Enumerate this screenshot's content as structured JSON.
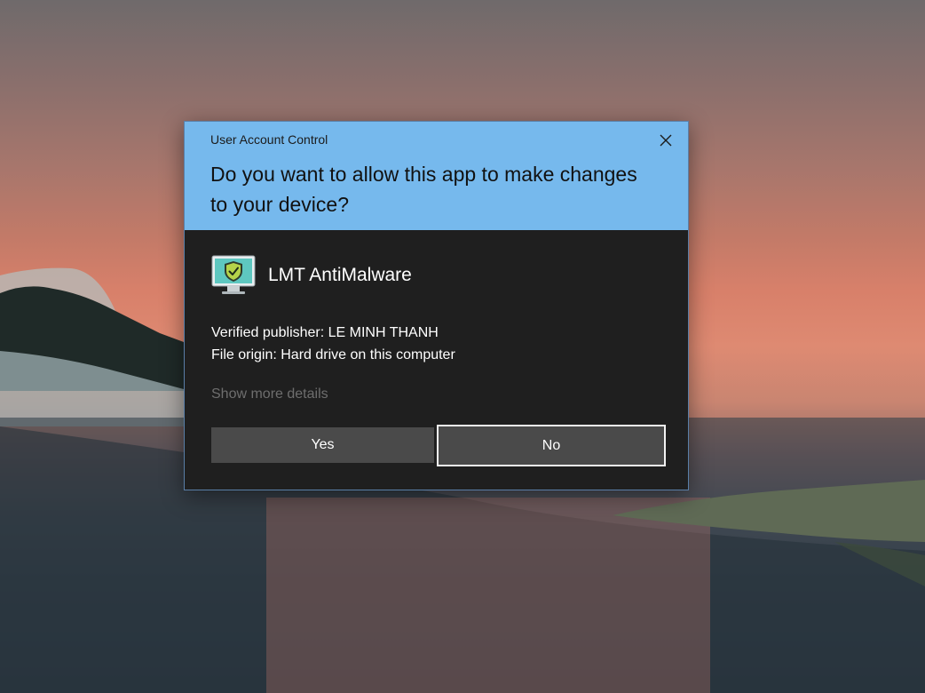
{
  "dialog": {
    "caption": "User Account Control",
    "question": "Do you want to allow this app to make changes to your device?",
    "app_name": "LMT AntiMalware",
    "app_icon": "monitor-shield-check-icon",
    "publisher_line": "Verified publisher: LE MINH THANH",
    "origin_line": "File origin: Hard drive on this computer",
    "more_details": "Show more details",
    "yes_label": "Yes",
    "no_label": "No",
    "close_icon": "close-icon"
  },
  "colors": {
    "header_bg": "#76b9ed",
    "body_bg": "#1f1f1f",
    "button_bg": "#4a4a4a",
    "link_muted": "#6e6e6e"
  }
}
